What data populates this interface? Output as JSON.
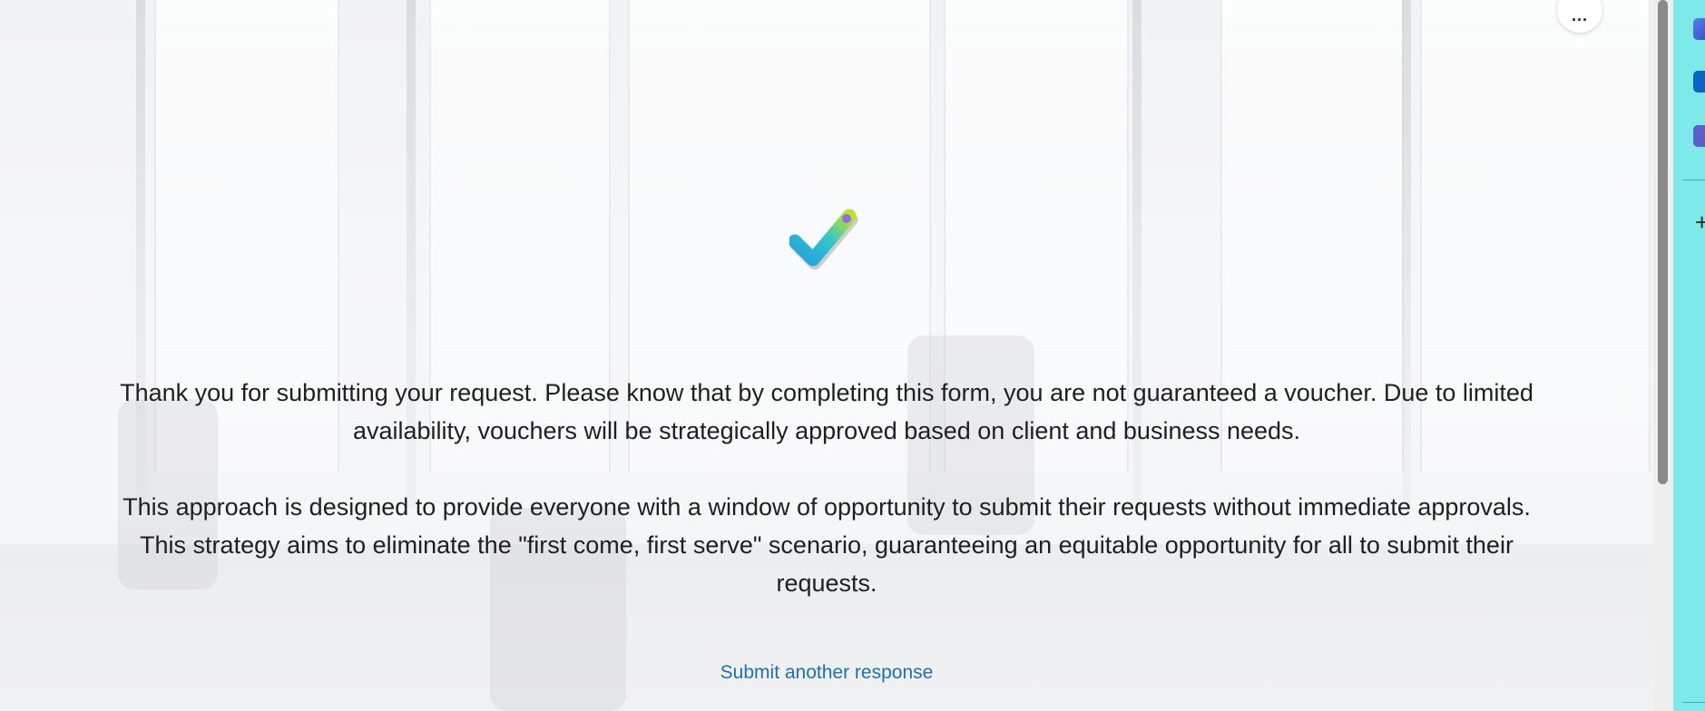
{
  "toolbar": {
    "more_options_label": "..."
  },
  "confirmation": {
    "icon": "checkmark-icon",
    "paragraph1": {
      "line1": "Thank you for submitting your request. Please know that by completing this form, you are not guaranteed a voucher. Due to limited",
      "line2": "availability, vouchers will be strategically approved based on client and business needs."
    },
    "paragraph2": {
      "line1": "This approach is designed to provide everyone with a window of opportunity to submit their requests without immediate approvals.",
      "line2": "This strategy aims to eliminate the \"first come, first serve\" scenario, guaranteeing an equitable opportunity for all to submit their",
      "line3": "requests."
    },
    "submit_another_label": "Submit another response"
  },
  "side_rail": {
    "items": [
      {
        "icon": "copilot-icon"
      },
      {
        "icon": "outlook-icon"
      },
      {
        "icon": "teams-icon"
      },
      {
        "icon": "add-icon"
      }
    ]
  },
  "colors": {
    "link": "#1f6fb5",
    "text": "#1f1f1f",
    "side_rail": "#7ee9e9",
    "check_gradient_start": "#1fa2e0",
    "check_gradient_end": "#b6e62a"
  }
}
